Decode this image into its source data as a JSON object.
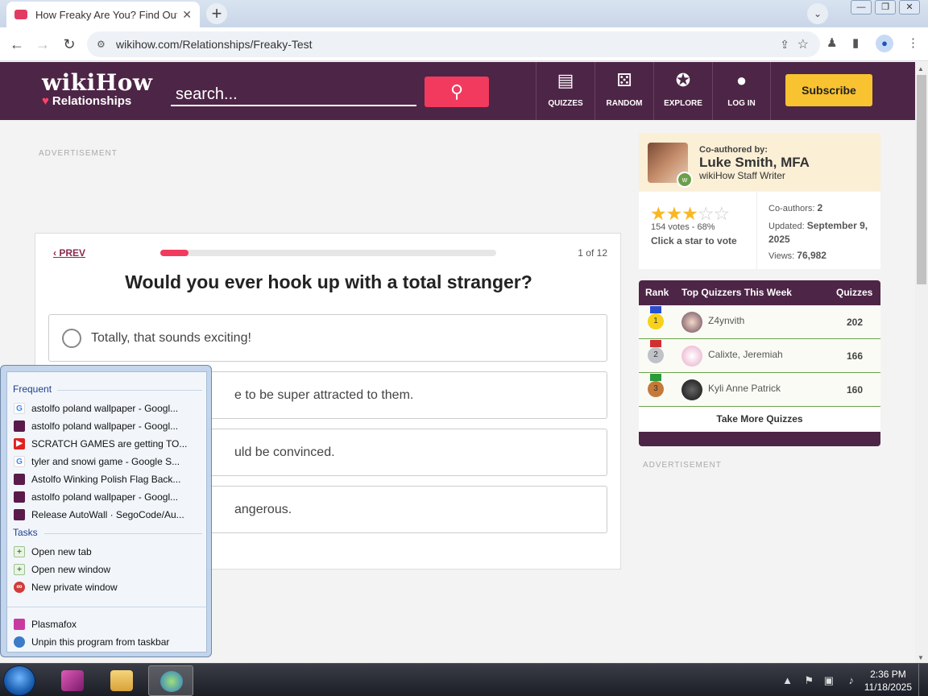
{
  "browser": {
    "tab_title": "How Freaky Are You? Find Out H",
    "url": "wikihow.com/Relationships/Freaky-Test",
    "window_buttons": [
      "—",
      "❐",
      "✕"
    ]
  },
  "header": {
    "logo_main": "wikiHow",
    "logo_sub": "Relationships",
    "search_placeholder": "search...",
    "nav": [
      {
        "label": "QUIZZES",
        "icon": "quizzes-icon"
      },
      {
        "label": "RANDOM",
        "icon": "dice-icon"
      },
      {
        "label": "EXPLORE",
        "icon": "compass-icon"
      },
      {
        "label": "LOG IN",
        "icon": "user-icon"
      }
    ],
    "subscribe_label": "Subscribe"
  },
  "ads": {
    "label": "ADVERTISEMENT"
  },
  "quiz": {
    "prev_label": "PREV",
    "progress_fraction": 0.083,
    "counter": "1 of 12",
    "question": "Would you ever hook up with a total stranger?",
    "answers": [
      "Totally, that sounds exciting!",
      "e to be super attracted to them.",
      "uld be convinced.",
      "angerous."
    ]
  },
  "author": {
    "coauthored_label": "Co-authored by:",
    "name": "Luke Smith, MFA",
    "role": "wikiHow Staff Writer"
  },
  "stats": {
    "rating_stars": 3,
    "rating_max": 5,
    "votes_text": "154 votes - 68%",
    "click_text": "Click a star to vote",
    "coauthors_label": "Co-authors:",
    "coauthors_value": "2",
    "updated_label": "Updated:",
    "updated_value": "September 9, 2025",
    "views_label": "Views:",
    "views_value": "76,982"
  },
  "leaderboard": {
    "header_rank": "Rank",
    "header_title": "Top Quizzers This Week",
    "header_quizzes": "Quizzes",
    "rows": [
      {
        "rank": "1",
        "name": "Z4ynvith",
        "score": "202",
        "medal_color": "#f6d21a",
        "ribbon_color": "#2a4fd0"
      },
      {
        "rank": "2",
        "name": "Calixte, Jeremiah",
        "score": "166",
        "medal_color": "#bfc3c8",
        "ribbon_color": "#d03030"
      },
      {
        "rank": "3",
        "name": "Kyli Anne Patrick",
        "score": "160",
        "medal_color": "#c47a3a",
        "ribbon_color": "#2a9a3a"
      }
    ],
    "take_more": "Take More Quizzes"
  },
  "jumplist": {
    "frequent_label": "Frequent",
    "frequent": [
      {
        "text": "astolfo poland wallpaper - Googl...",
        "icon": "google"
      },
      {
        "text": "astolfo poland wallpaper - Googl...",
        "icon": "wh"
      },
      {
        "text": "SCRATCH GAMES are getting TO...",
        "icon": "yt"
      },
      {
        "text": "tyler and snowi game - Google S...",
        "icon": "google"
      },
      {
        "text": "Astolfo Winking Polish Flag Back...",
        "icon": "wh"
      },
      {
        "text": "astolfo poland wallpaper - Googl...",
        "icon": "wh"
      },
      {
        "text": "Release AutoWall · SegoCode/Au...",
        "icon": "wh"
      }
    ],
    "tasks_label": "Tasks",
    "tasks": [
      "Open new tab",
      "Open new window",
      "New private window"
    ],
    "app_name": "Plasmafox",
    "unpin": "Unpin this program from taskbar"
  },
  "taskbar": {
    "time": "2:36 PM",
    "date": "11/18/2025"
  }
}
